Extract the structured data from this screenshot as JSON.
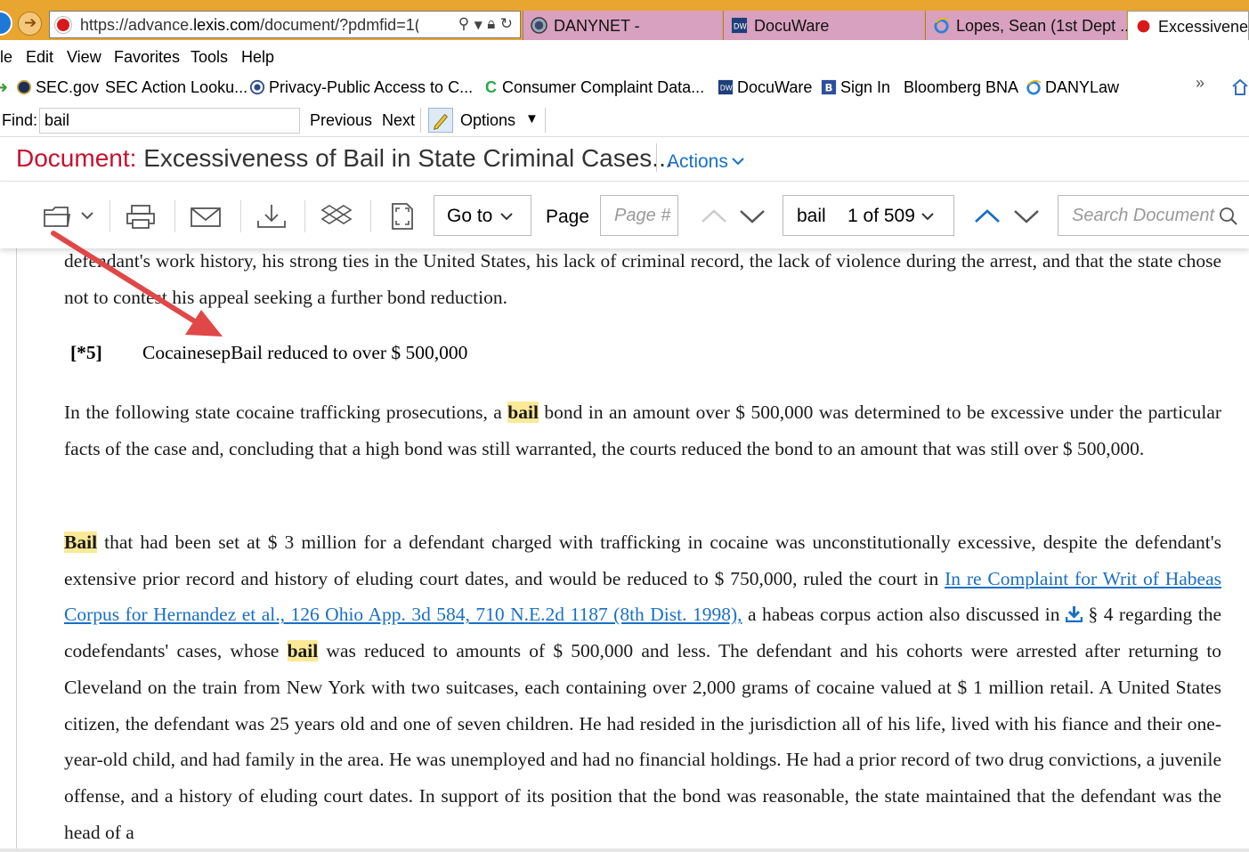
{
  "browser": {
    "url_prefix": "https://advance.",
    "url_domain": "lexis.com",
    "url_rest": "/document/?pdmfid=1(",
    "tabs": [
      {
        "label": "DANYNET -"
      },
      {
        "label": "DocuWare"
      },
      {
        "label": "Lopes, Sean (1st Dept ..."
      },
      {
        "label": "Excessiveness"
      }
    ],
    "menu": [
      "le",
      "Edit",
      "View",
      "Favorites",
      "Tools",
      "Help"
    ],
    "favorites": [
      {
        "label": "SEC.gov"
      },
      {
        "label": "SEC Action Looku..."
      },
      {
        "label": "Privacy-Public Access to C..."
      },
      {
        "label": "Consumer Complaint Data..."
      },
      {
        "label": "DocuWare"
      },
      {
        "label": "Sign In"
      },
      {
        "label": "Bloomberg BNA"
      },
      {
        "label": "DANYLaw"
      }
    ],
    "favorites_more": "»",
    "find": {
      "label": "Find:",
      "value": "bail",
      "previous": "Previous",
      "next": "Next",
      "options": "Options"
    }
  },
  "document": {
    "label": "Document:",
    "title": "Excessiveness of Bail in State Criminal Cases...",
    "actions": "Actions"
  },
  "toolbar": {
    "goto": "Go to",
    "page_label": "Page",
    "page_placeholder": "Page #",
    "term": "bail",
    "term_count": "1 of 509",
    "search_placeholder": "Search Document"
  },
  "content": {
    "para1": "defendant's work history, his strong ties in the United States, his lack of criminal record, the lack of violence during the arrest, and that the state chose not to contest his appeal seeking a further bond reduction.",
    "section_num": "[*5]",
    "section_title": "CocainesepBail reduced to over $ 500,000",
    "para2_a": "In the following state cocaine trafficking prosecutions, a",
    "para2_hl": "bail",
    "para2_b": "bond in an amount over $ 500,000 was determined to be excessive under the particular facts of the case and, concluding that a high bond was still warranted, the courts reduced the bond to an amount that was still over $ 500,000.",
    "para3_hl1": "Bail",
    "para3_a": "that had been set at $ 3 million for a defendant charged with trafficking in cocaine was unconstitutionally excessive, despite the defendant's extensive prior record and history of eluding court dates, and would be reduced to $ 750,000, ruled the court in",
    "para3_link": "In re Complaint for Writ of Habeas Corpus for Hernandez et al., 126 Ohio App. 3d 584, 710 N.E.2d 1187 (8th Dist. 1998),",
    "para3_b": "a habeas corpus action also discussed in",
    "para3_c": "§ 4 regarding the codefendants' cases, whose",
    "para3_hl2": "bail",
    "para3_d": "was reduced to amounts of $ 500,000 and less. The defendant and his cohorts were arrested after returning to Cleveland on the train from New York with two suitcases, each containing over 2,000 grams of cocaine valued at $ 1 million retail. A United States citizen, the defendant was 25 years old and one of seven children. He had resided in the jurisdiction all of his life, lived with his fiance and their one-year-old child, and had family in the area. He was unemployed and had no financial holdings. He had a prior record of two drug convictions, a juvenile offense, and a history of eluding court dates. In support of its position that the bond was reasonable, the state maintained that the defendant was the head of a"
  },
  "colors": {
    "tabbar": "#e8a52f",
    "inactive_tab": "#d8a1bf",
    "lexis_red": "#c8102e",
    "link_blue": "#1a6fc4",
    "highlight": "#fbe996",
    "annotation_arrow": "#e04848"
  }
}
